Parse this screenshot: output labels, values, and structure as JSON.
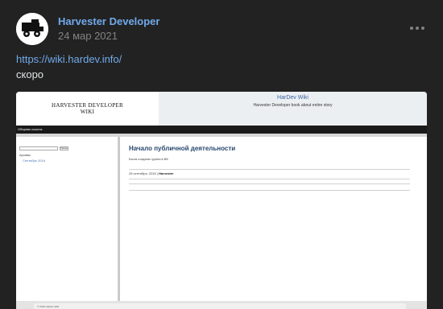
{
  "post": {
    "author": "Harvester Developer",
    "date": "24 мар 2021",
    "link": "https://wiki.hardev.info/",
    "text": "скоро",
    "more_icon": "more-horizontal-icon"
  },
  "preview": {
    "logo_line1": "HARVESTER DEVELOPER",
    "logo_line2": "WIKI",
    "site_title": "HarDev Wiki",
    "site_description": "Harvester Developer book about entire story",
    "nav_item": "Оборник ссылок",
    "search_button": "Поиск",
    "archives_label": "Архивы",
    "archive_link": "Сентябрь 2016",
    "post_title": "Начало публичной деятельности",
    "post_body": "Была создана группа в ВК",
    "post_meta_date": "26 сентября, 2016 |",
    "post_meta_author": "Harvester",
    "footer_text": "© 2016 HarDev Wiki"
  },
  "colors": {
    "background": "#222222",
    "author": "#71aaeb",
    "link": "#71aaeb",
    "muted": "#828282",
    "text": "#e1e3e6"
  }
}
